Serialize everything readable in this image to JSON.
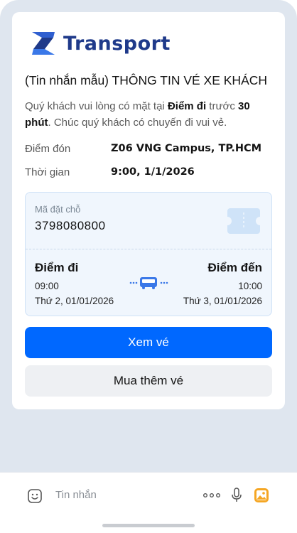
{
  "brand": {
    "name": "Transport"
  },
  "message": {
    "title": "(Tin nhắn mẫu) THÔNG TIN VÉ XE KHÁCH",
    "desc_part1": "Quý khách vui lòng có mặt tại ",
    "desc_bold1": "Điểm đi",
    "desc_part2": " trước ",
    "desc_bold2": "30 phút",
    "desc_part3": ". Chúc quý khách có chuyến đi vui vẻ.",
    "pickup_label": "Điểm đón",
    "pickup_value": "Z06 VNG Campus, TP.HCM",
    "time_label": "Thời gian",
    "time_value": "9:00, 1/1/2026"
  },
  "ticket": {
    "code_label": "Mã đặt chỗ",
    "code": "3798080800",
    "from_label": "Điểm đi",
    "to_label": "Điểm đến",
    "from_time": "09:00",
    "to_time": "10:00",
    "from_date": "Thứ 2, 01/01/2026",
    "to_date": "Thứ 3, 01/01/2026",
    "icon": "ticket-icon",
    "bus_icon": "bus-icon"
  },
  "buttons": {
    "view": "Xem vé",
    "buy_more": "Mua thêm vé"
  },
  "input_bar": {
    "placeholder": "Tin nhắn",
    "icons": [
      "emoji-icon",
      "more-icon",
      "mic-icon",
      "image-icon"
    ]
  },
  "colors": {
    "primary": "#0068ff",
    "brand": "#1f3a8a",
    "ticket_bg": "#f0f6fd",
    "image_icon": "#f5a623"
  }
}
